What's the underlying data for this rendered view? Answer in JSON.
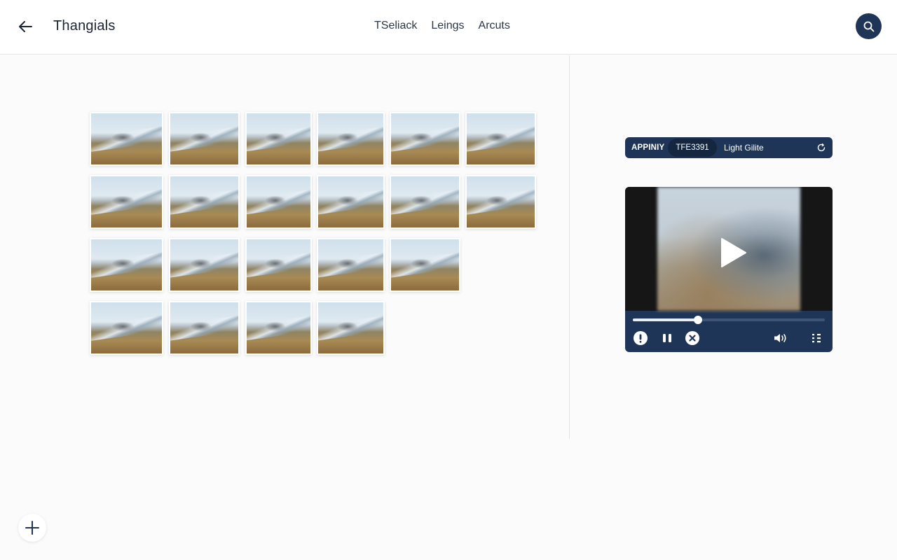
{
  "header": {
    "title": "Thangials",
    "nav": [
      "TSeliack",
      "Leings",
      "Arcuts"
    ],
    "back_icon": "arrow-left-icon",
    "search_icon": "search-icon"
  },
  "gallery": {
    "rows": [
      6,
      6,
      5,
      4
    ],
    "thumbnail_alt": "landscape thumbnail"
  },
  "pill_bar": {
    "segments": [
      "APPINIY",
      "TFE3391",
      "Light Gilite"
    ],
    "active_index": 1,
    "refresh_icon": "refresh-icon"
  },
  "player": {
    "progress": 0.34,
    "controls": [
      "info-icon",
      "pause-icon",
      "close-icon",
      "volume-icon",
      "playlist-icon"
    ]
  },
  "fab": {
    "icon": "plus-icon"
  },
  "colors": {
    "accent": "#1e3557",
    "background": "#fbfbfb",
    "header_bg": "#ffffff"
  }
}
